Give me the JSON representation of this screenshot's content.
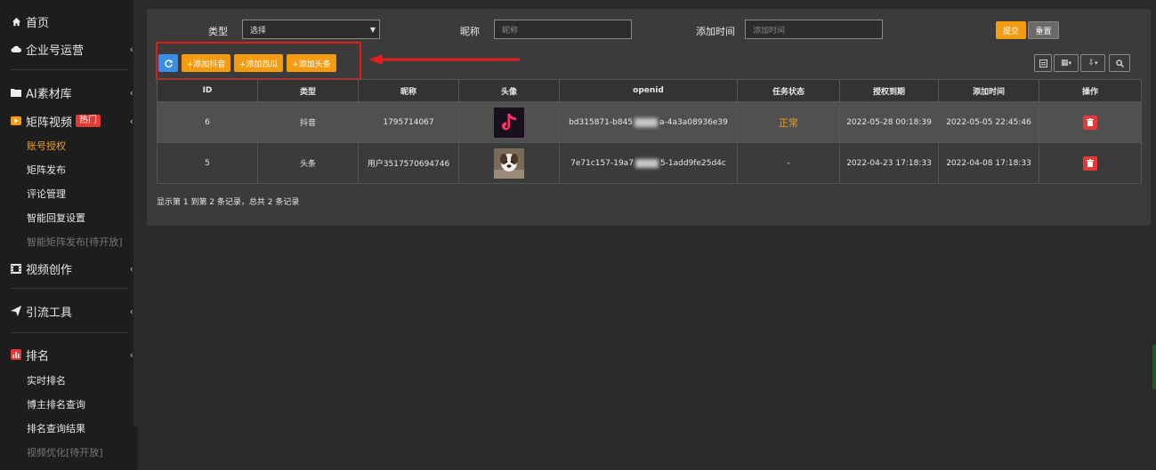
{
  "sidebar": {
    "home": "首页",
    "enterprise": "企业号运营",
    "ai_materials": "AI素材库",
    "matrix_video": "矩阵视频",
    "hot_badge": "热门",
    "matrix_sub": [
      "账号授权",
      "矩阵发布",
      "评论管理",
      "智能回复设置",
      "智能矩阵发布[待开放]"
    ],
    "video_creation": "视频创作",
    "traffic_tools": "引流工具",
    "ranking": "排名",
    "ranking_sub": [
      "实时排名",
      "博主排名查询",
      "排名查询结果",
      "视频优化[待开放]"
    ]
  },
  "filters": {
    "type_label": "类型",
    "type_value": "选择",
    "nickname_label": "昵称",
    "nickname_placeholder": "昵称",
    "time_label": "添加时间",
    "time_placeholder": "添加时间",
    "submit": "提交",
    "reset": "重置"
  },
  "toolbar": {
    "add_douyin": "+添加抖音",
    "add_xigua": "+添加西瓜",
    "add_toutiao": "+添加头条"
  },
  "table": {
    "headers": [
      "ID",
      "类型",
      "昵称",
      "头像",
      "openid",
      "任务状态",
      "授权到期",
      "添加时间",
      "操作"
    ],
    "rows": [
      {
        "id": "6",
        "type": "抖音",
        "nickname": "1795714067",
        "openid_a": "bd315871-b845",
        "openid_b": "a-4a3a08936e39",
        "status": "正常",
        "expire": "2022-05-28 00:18:39",
        "added": "2022-05-05 22:45:46"
      },
      {
        "id": "5",
        "type": "头条",
        "nickname": "用户3517570694746",
        "openid_a": "7e71c157-19a7",
        "openid_b": "5-1add9fe25d4c",
        "status": "-",
        "expire": "2022-04-23 17:18:33",
        "added": "2022-04-08 17:18:33"
      }
    ],
    "footer": "显示第 1 到第 2 条记录，总共 2 条记录"
  }
}
